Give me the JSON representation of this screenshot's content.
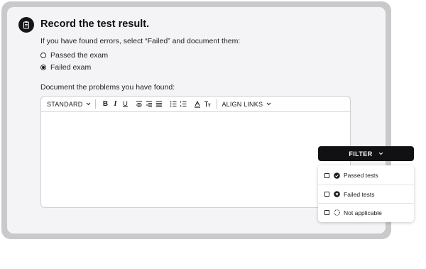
{
  "form": {
    "title": "Record the test result.",
    "instruction": "If you have found errors, select “Failed” and document them:",
    "options": [
      {
        "label": "Passed the exam",
        "selected": false
      },
      {
        "label": "Failed exam",
        "selected": true
      }
    ],
    "document_label": "Document the problems you have found:"
  },
  "editor": {
    "style_select": "STANDARD",
    "align_select": "ALIGN LINKS",
    "content": ""
  },
  "filter": {
    "label": "FILTER",
    "items": [
      {
        "label": "Passed tests",
        "icon": "check-circle-icon",
        "checked": false
      },
      {
        "label": "Failed tests",
        "icon": "x-circle-icon",
        "checked": false
      },
      {
        "label": "Not applicable",
        "icon": "dashed-circle-icon",
        "checked": false
      }
    ]
  },
  "colors": {
    "frame": "#c9c9cc",
    "card": "#f4f4f6",
    "dark": "#111113"
  }
}
